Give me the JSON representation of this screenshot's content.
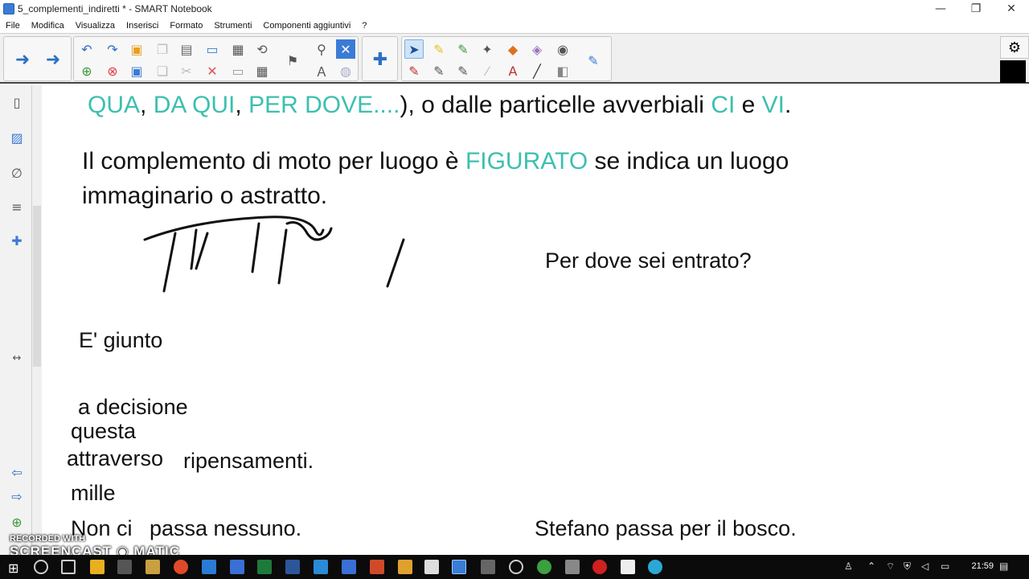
{
  "window": {
    "title": "5_complementi_indiretti * - SMART Notebook",
    "controls": [
      "—",
      "❐",
      "✕"
    ]
  },
  "menu": [
    "File",
    "Modifica",
    "Visualizza",
    "Inserisci",
    "Formato",
    "Strumenti",
    "Componenti aggiuntivi",
    "?"
  ],
  "toolbar": {
    "icons": [
      "back-arrow-icon",
      "forward-arrow-icon",
      "undo-icon",
      "redo-icon",
      "open-icon",
      "paste-icon",
      "screen-capture-icon",
      "table-icon",
      "select-icon",
      "pen-icon",
      "highlighter-icon",
      "magic-pen-icon",
      "shapes-icon",
      "eraser-icon",
      "text-icon",
      "line-icon",
      "fill-icon",
      "properties-icon",
      "settings-icon"
    ]
  },
  "canvas": {
    "line1": {
      "items": [
        {
          "text": "QUA",
          "teal": true
        },
        {
          "text": ", ",
          "teal": false
        },
        {
          "text": "DA QUI",
          "teal": true
        },
        {
          "text": ", ",
          "teal": false
        },
        {
          "text": "PER DOVE....",
          "teal": true
        },
        {
          "text": "), o dalle particelle avverbiali ",
          "teal": false
        },
        {
          "text": "CI",
          "teal": true
        },
        {
          "text": " e ",
          "teal": false
        },
        {
          "text": "VI",
          "teal": true
        },
        {
          "text": ".",
          "teal": false
        }
      ]
    },
    "para2_a": "Il complemento di moto per luogo è ",
    "para2_teal": "FIGURATO",
    "para2_b": " se indica un luogo",
    "para2_line2": "immaginario o astratto.",
    "question": "Per dove sei entrato?",
    "e_giunto": "E' giunto",
    "a_decisione": "a  decisione",
    "questa": "questa",
    "attraverso": "attraverso",
    "ripensamenti": "ripensamenti.",
    "mille": "mille",
    "non_ci": "Non ci",
    "passa_nessuno": "passa  nessuno.",
    "stefano": "Stefano  passa  per il bosco."
  },
  "watermark": {
    "line1": "RECORDED WITH",
    "line2": "SCREENCAST ◉ MATIC"
  },
  "taskbar": {
    "clock": "21:59"
  }
}
